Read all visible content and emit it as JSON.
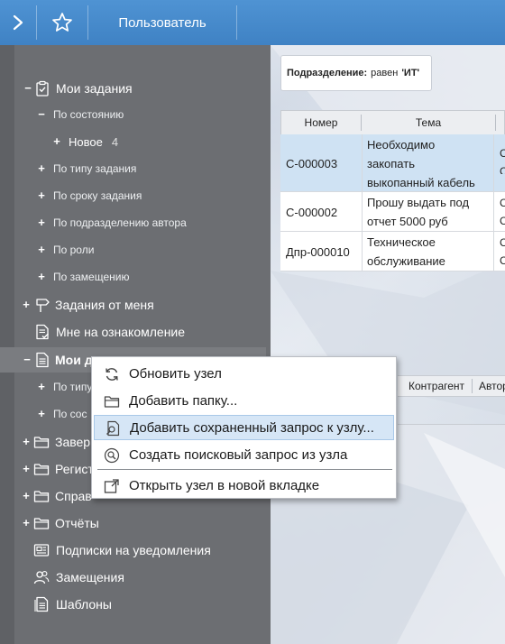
{
  "topbar": {
    "title": "Пользователь",
    "icons": [
      "chevron-right-icon",
      "star-icon"
    ]
  },
  "tree": {
    "items": [
      {
        "toggle": "−",
        "icon": "clipboard-check-icon",
        "label": "Мои задания"
      },
      {
        "toggle": "−",
        "label": "По состоянию"
      },
      {
        "toggle": "+",
        "label": "Новое",
        "count": "4"
      },
      {
        "toggle": "+",
        "label": "По типу задания"
      },
      {
        "toggle": "+",
        "label": "По сроку задания"
      },
      {
        "toggle": "+",
        "label": "По подразделению автора"
      },
      {
        "toggle": "+",
        "label": "По роли"
      },
      {
        "toggle": "+",
        "label": "По замещению"
      },
      {
        "toggle": "+",
        "icon": "signpost-icon",
        "label": "Задания от меня"
      },
      {
        "icon": "document-check-icon",
        "label": "Мне на ознакомление"
      },
      {
        "toggle": "−",
        "icon": "document-icon",
        "label": "Мои д"
      },
      {
        "toggle": "+",
        "label": "По типу"
      },
      {
        "toggle": "+",
        "label": "По сос"
      },
      {
        "toggle": "+",
        "icon": "folder-icon",
        "label": "Завер"
      },
      {
        "toggle": "+",
        "icon": "folder-icon",
        "label": "Регист"
      },
      {
        "toggle": "+",
        "icon": "folder-icon",
        "label": "Справ"
      },
      {
        "toggle": "+",
        "icon": "folder-icon",
        "label": "Отчёты"
      },
      {
        "icon": "subscription-icon",
        "label": "Подписки на уведомления"
      },
      {
        "icon": "users-icon",
        "label": "Замещения"
      },
      {
        "icon": "template-icon",
        "label": "Шаблоны"
      }
    ]
  },
  "filter": {
    "field": "Подразделение:",
    "operator": "равен",
    "value": "'ИТ'"
  },
  "grid": {
    "columns": [
      "Номер",
      "Тема"
    ],
    "rows": [
      {
        "number": "С-000003",
        "topic": [
          "Необходимо",
          "закопать",
          "выкопанный кабель"
        ],
        "edge": [
          "С",
          "С"
        ]
      },
      {
        "number": "С-000002",
        "topic": [
          "Прошу выдать под",
          "отчет 5000 руб"
        ],
        "edge": [
          "С",
          "С"
        ]
      },
      {
        "number": "Дпр-000010",
        "topic": [
          "Техническое",
          "обслуживание"
        ],
        "edge": [
          "С",
          "С"
        ]
      }
    ]
  },
  "grid2": {
    "columns": [
      "Контрагент",
      "Автор"
    ]
  },
  "context_menu": {
    "items": [
      {
        "icon": "refresh-icon",
        "label": "Обновить узел"
      },
      {
        "icon": "folder-add-icon",
        "label": "Добавить папку..."
      },
      {
        "icon": "saved-query-icon",
        "label": "Добавить сохраненный запрос к узлу..."
      },
      {
        "icon": "search-query-icon",
        "label": "Создать поисковый запрос из узла"
      },
      {
        "icon": "open-new-tab-icon",
        "label": "Открыть узел в новой вкладке"
      }
    ]
  },
  "colors": {
    "topbar": "#4a8fd0",
    "sidebar": "#6c6e72",
    "selected_row": "#cfe2f3",
    "menu_hover": "#d6e6f6"
  }
}
